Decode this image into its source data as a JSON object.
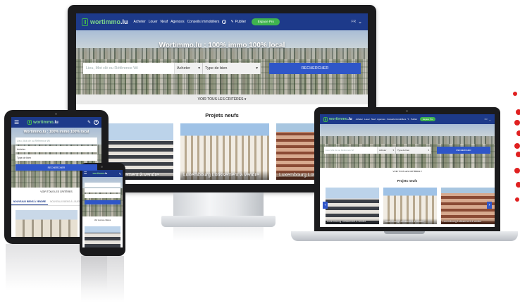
{
  "site": {
    "logo_brand": "wortimmo",
    "logo_tld": ".lu",
    "logo_tagline": "LES PROFESSIONNELS DE L'IMMOBILIER",
    "nav_links": [
      "Acheter",
      "Louer",
      "Neuf",
      "Agences",
      "Conseils immobiliers"
    ],
    "publish_label": "Publier",
    "pro_button": "Espace Pro",
    "lang": "FR",
    "hero_title": "Wortimmo.lu : 100% immo 100% local",
    "search_placeholder": "Lieu, Mot clé ou Référence Wi",
    "transaction_select": "Acheter",
    "property_select": "Type de bien",
    "search_button": "RECHERCHER",
    "criteria_link": "VOIR TOUS LES CRITÈRES",
    "section_title": "Projets neufs",
    "cards": [
      {
        "caption": "Luxembourg Lotissement à vendre"
      },
      {
        "caption": "Luxembourg Lotissement à vendre"
      },
      {
        "caption": "Luxembourg Lotissement à vendre"
      }
    ]
  },
  "tablet": {
    "hero_title": "Wortimmo.lu : 100% immo 100% local",
    "search_placeholder": "Lieu, Mot clé ou Référence Wi",
    "transaction_select": "Acheter",
    "property_select": "Type de bien",
    "search_button": "RECHERCHER",
    "criteria_link": "VOIR TOUS LES CRITÈRES",
    "tab_active": "NOUVEAUX BIENS À VENDRE",
    "tab_other": "NOUVEAUX BIENS À LOUER"
  },
  "phone": {
    "criteria_link": "Voir tous les critères"
  },
  "colors": {
    "brand_blue": "#1d3a8a",
    "button_blue": "#2f56c8",
    "accent_green": "#3fb34f",
    "decor_red": "#e02020"
  },
  "icons": [
    "hamburger-icon",
    "edit-icon",
    "user-icon",
    "chevron-down-icon",
    "info-icon",
    "arrow-left-icon",
    "arrow-right-icon"
  ]
}
